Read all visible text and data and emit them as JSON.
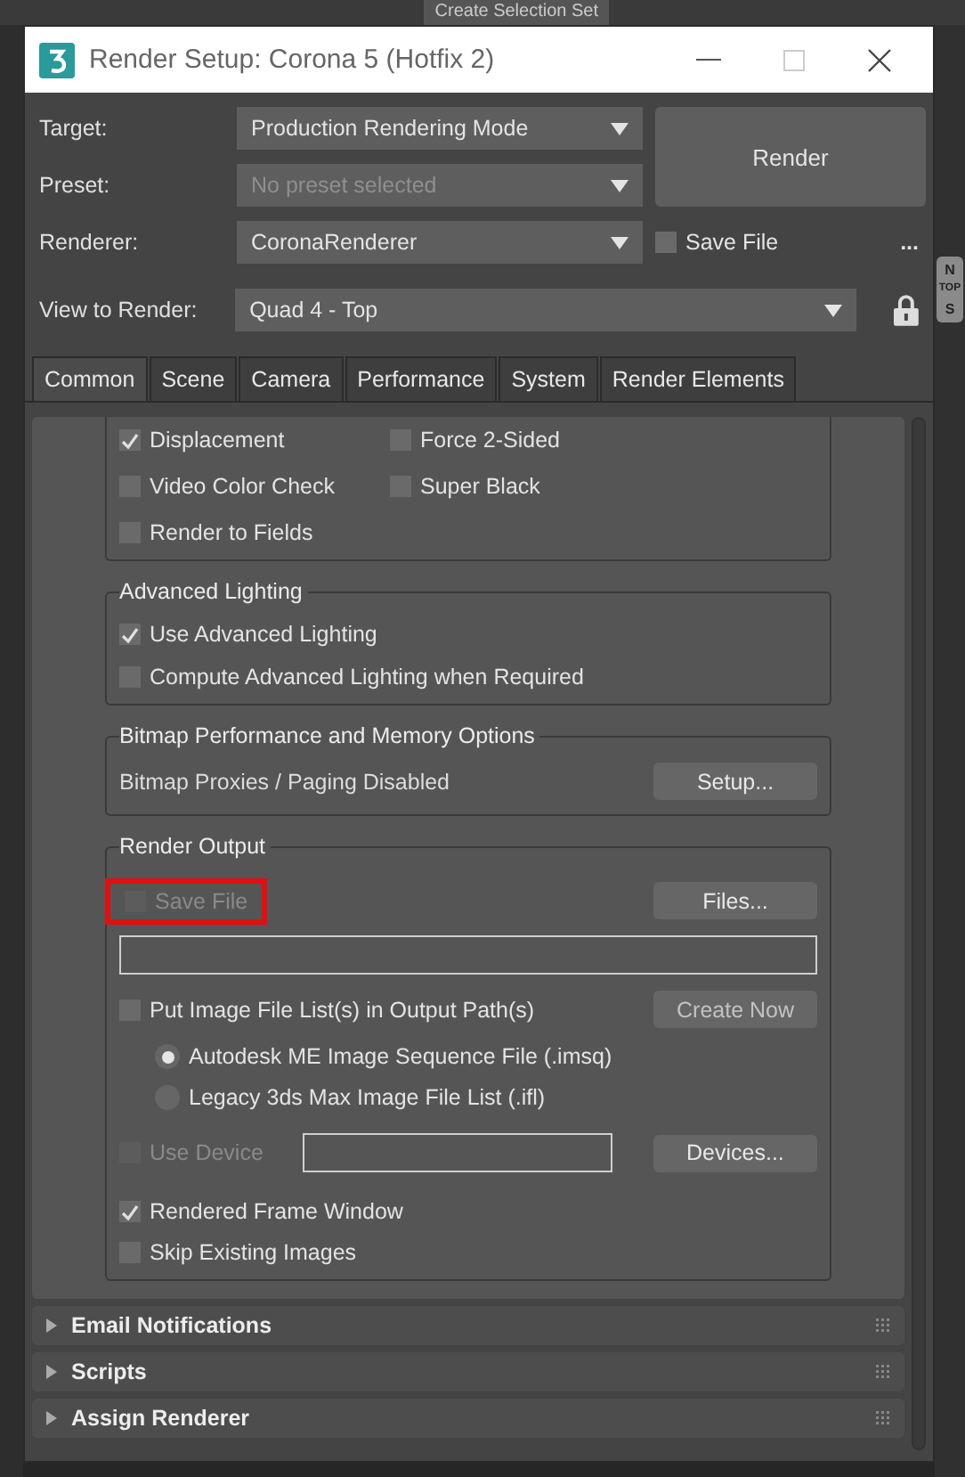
{
  "background": {
    "toolbar_label": "Create Selection Set",
    "viewcube_labels": [
      "N",
      "TOP",
      "S"
    ]
  },
  "window": {
    "title": "Render Setup: Corona 5 (Hotfix 2)"
  },
  "header": {
    "fields": [
      {
        "label": "Target:",
        "value": "Production Rendering Mode",
        "disabled": false
      },
      {
        "label": "Preset:",
        "value": "No preset selected",
        "disabled": true
      },
      {
        "label": "Renderer:",
        "value": "CoronaRenderer",
        "disabled": false
      }
    ],
    "render_button": "Render",
    "save_file": {
      "label": "Save File",
      "checked": false
    },
    "more_button": "...",
    "view_to_render": {
      "label": "View to Render:",
      "value": "Quad 4 - Top"
    }
  },
  "tabs": [
    {
      "label": "Common",
      "selected": true
    },
    {
      "label": "Scene",
      "selected": false
    },
    {
      "label": "Camera",
      "selected": false
    },
    {
      "label": "Performance",
      "selected": false
    },
    {
      "label": "System",
      "selected": false
    },
    {
      "label": "Render Elements",
      "selected": false
    }
  ],
  "options": [
    {
      "label": "Displacement",
      "checked": true
    },
    {
      "label": "Force 2-Sided",
      "checked": false
    },
    {
      "label": "Video Color Check",
      "checked": false
    },
    {
      "label": "Super Black",
      "checked": false
    },
    {
      "label": "Render to Fields",
      "checked": false
    }
  ],
  "advanced_lighting": {
    "title": "Advanced Lighting",
    "options": [
      {
        "label": "Use Advanced Lighting",
        "checked": true
      },
      {
        "label": "Compute Advanced Lighting when Required",
        "checked": false
      }
    ]
  },
  "bitmap": {
    "title": "Bitmap Performance and Memory Options",
    "status": "Bitmap Proxies / Paging Disabled",
    "button": "Setup..."
  },
  "render_output": {
    "title": "Render Output",
    "save_file": {
      "label": "Save File",
      "checked": false,
      "disabled": true,
      "highlighted": true
    },
    "files_button": "Files...",
    "image_list": {
      "label": "Put Image File List(s) in Output Path(s)",
      "checked": false
    },
    "create_button": {
      "label": "Create Now",
      "disabled": true
    },
    "formats": [
      {
        "label": "Autodesk ME Image Sequence File (.imsq)",
        "selected": true
      },
      {
        "label": "Legacy 3ds Max Image File List (.ifl)",
        "selected": false
      }
    ],
    "use_device": {
      "label": "Use Device",
      "checked": false,
      "disabled": true
    },
    "devices_button": "Devices...",
    "rendered_frame_window": {
      "label": "Rendered Frame Window",
      "checked": true
    },
    "skip_existing": {
      "label": "Skip Existing Images",
      "checked": false
    }
  },
  "rollouts": [
    {
      "title": "Email Notifications",
      "expanded": false
    },
    {
      "title": "Scripts",
      "expanded": false
    },
    {
      "title": "Assign Renderer",
      "expanded": false
    }
  ]
}
